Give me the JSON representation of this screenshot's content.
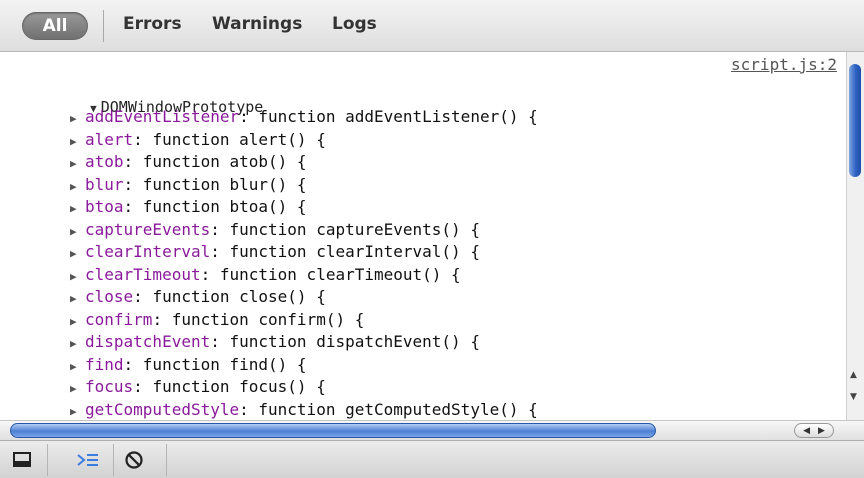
{
  "filter_bar": {
    "all_label": "All",
    "filters": [
      "Errors",
      "Warnings",
      "Logs"
    ]
  },
  "console": {
    "source_link": "script.js:2",
    "group_label": "DOMWindowPrototype",
    "properties": [
      {
        "key": "addEventListener",
        "value": ": function addEventListener() {"
      },
      {
        "key": "alert",
        "value": ": function alert() {"
      },
      {
        "key": "atob",
        "value": ": function atob() {"
      },
      {
        "key": "blur",
        "value": ": function blur() {"
      },
      {
        "key": "btoa",
        "value": ": function btoa() {"
      },
      {
        "key": "captureEvents",
        "value": ": function captureEvents() {"
      },
      {
        "key": "clearInterval",
        "value": ": function clearInterval() {"
      },
      {
        "key": "clearTimeout",
        "value": ": function clearTimeout() {"
      },
      {
        "key": "close",
        "value": ": function close() {"
      },
      {
        "key": "confirm",
        "value": ": function confirm() {"
      },
      {
        "key": "dispatchEvent",
        "value": ": function dispatchEvent() {"
      },
      {
        "key": "find",
        "value": ": function find() {"
      },
      {
        "key": "focus",
        "value": ": function focus() {"
      },
      {
        "key": "getComputedStyle",
        "value": ": function getComputedStyle() {"
      }
    ]
  },
  "toolbar": {
    "icons": [
      "dock-window-icon",
      "console-prompt-icon",
      "clear-console-icon"
    ]
  },
  "colors": {
    "property_key": "#8a1a9b",
    "scroll_thumb": "#2f63c4"
  }
}
